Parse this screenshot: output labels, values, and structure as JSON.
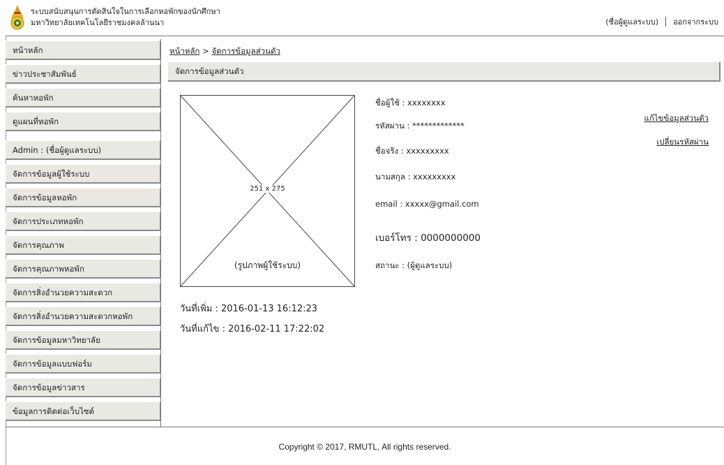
{
  "header": {
    "title_line1": "ระบบสนับสนุนการตัดสินใจในการเลือกหอพักของนักศึกษา",
    "title_line2": "มหาวิทยาลัยเทคโนโลยีราชมงคลล้านนา",
    "user_label": "(ชื่อผู้ดูแลระบบ)",
    "logout_label": "ออกจากระบบ",
    "logo_icon": "university-emblem-icon"
  },
  "sidebar": {
    "items": [
      {
        "label": "หน้าหลัก"
      },
      {
        "label": "ข่าวประชาสัมพันธ์"
      },
      {
        "label": "ค้นหาหอพัก"
      },
      {
        "label": "ดูแผนที่หอพัก"
      },
      {
        "label": "Admin : (ชื่อผู้ดูแลระบบ)"
      },
      {
        "label": "จัดการข้อมูลผู้ใช้ระบบ"
      },
      {
        "label": "จัดการข้อมูลหอพัก"
      },
      {
        "label": "จัดการประเภทหอพัก"
      },
      {
        "label": "จัดการคุณภาพ"
      },
      {
        "label": "จัดการคุณภาพหอพัก"
      },
      {
        "label": "จัดการสิ่งอำนวยความสะดวก"
      },
      {
        "label": "จัดการสิ่งอำนวยความสะดวกหอพัก"
      },
      {
        "label": "จัดการข้อมูลมหาวิทยาลัย"
      },
      {
        "label": "จัดการข้อมูลแบบฟอร์ม"
      },
      {
        "label": "จัดการข้อมูลข่าวสาร"
      },
      {
        "label": "ข้อมูลการติดต่อเว็บไซต์"
      }
    ]
  },
  "breadcrumb": {
    "home": "หน้าหลัก",
    "separator": ">",
    "current": "จัดการข้อมูลส่วนตัว"
  },
  "section": {
    "title": "จัดการข้อมูลส่วนตัว"
  },
  "photo": {
    "size_label": "251 x 275",
    "caption": "(รูปภาพผู้ใช้ระบบ)"
  },
  "profile": {
    "username": "ชื่อผู้ใช้ : xxxxxxxx",
    "password": "รหัสผ่าน : *************",
    "firstname": "ชื่อจริง : xxxxxxxxx",
    "lastname": "นามสกุล : xxxxxxxxx",
    "email": "email : xxxxx@gmail.com",
    "phone": "เบอร์โทร : 0000000000",
    "status": "สถานะ : (ผู้ดูแลระบบ)",
    "created": "วันที่เพิ่ม : 2016-01-13 16:12:23",
    "modified": "วันที่แก้ไข : 2016-02-11 17:22:02"
  },
  "actions": {
    "edit_profile": "แก้ไขข้อมูลส่วนตัว",
    "change_password": "เปลี่ยนรหัสผ่าน"
  },
  "footer": {
    "copyright": "Copyright © 2017, RMUTL, All rights reserved."
  }
}
